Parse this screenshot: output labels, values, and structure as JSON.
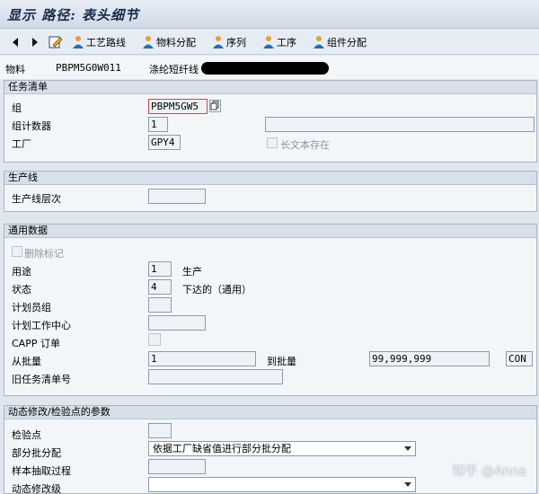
{
  "title": "显示 路径: 表头细节",
  "toolbar": {
    "back_icon": "arrow-left-icon",
    "forward_icon": "arrow-right-icon",
    "edit_icon": "pencil-icon",
    "routing": "工艺路线",
    "material_assignment": "物料分配",
    "sequence": "序列",
    "operation": "工序",
    "component_assignment": "组件分配"
  },
  "header": {
    "material_label": "物料",
    "material_value": "PBPM5G0W011",
    "material_desc": "涤纶短纤线"
  },
  "task_list": {
    "title": "任务清单",
    "group_label": "组",
    "group_value": "PBPM5GW5",
    "counter_label": "组计数器",
    "counter_value": "1",
    "plant_label": "工厂",
    "plant_value": "GPY4",
    "longtext_label": "长文本存在"
  },
  "production_line": {
    "title": "生产线",
    "level_label": "生产线层次"
  },
  "general": {
    "title": "通用数据",
    "delete_label": "删除标记",
    "usage_label": "用途",
    "usage_value": "1",
    "usage_text": "生产",
    "status_label": "状态",
    "status_value": "4",
    "status_text": "下达的（通用）",
    "planner_group_label": "计划员组",
    "work_center_label": "计划工作中心",
    "capp_label": "CAPP 订单",
    "from_lot_label": "从批量",
    "from_lot_value": "1",
    "to_lot_label": "到批量",
    "to_lot_value": "99,999,999",
    "unit_value": "CON",
    "old_list_label": "旧任务清单号"
  },
  "dynamic": {
    "title": "动态修改/检验点的参数",
    "inspection_point_label": "检验点",
    "partial_lot_label": "部分批分配",
    "partial_lot_value": "依据工厂缺省值进行部分批分配",
    "sample_label": "样本抽取过程",
    "dyn_level_label": "动态修改级"
  },
  "watermark": "知乎 @Anna"
}
